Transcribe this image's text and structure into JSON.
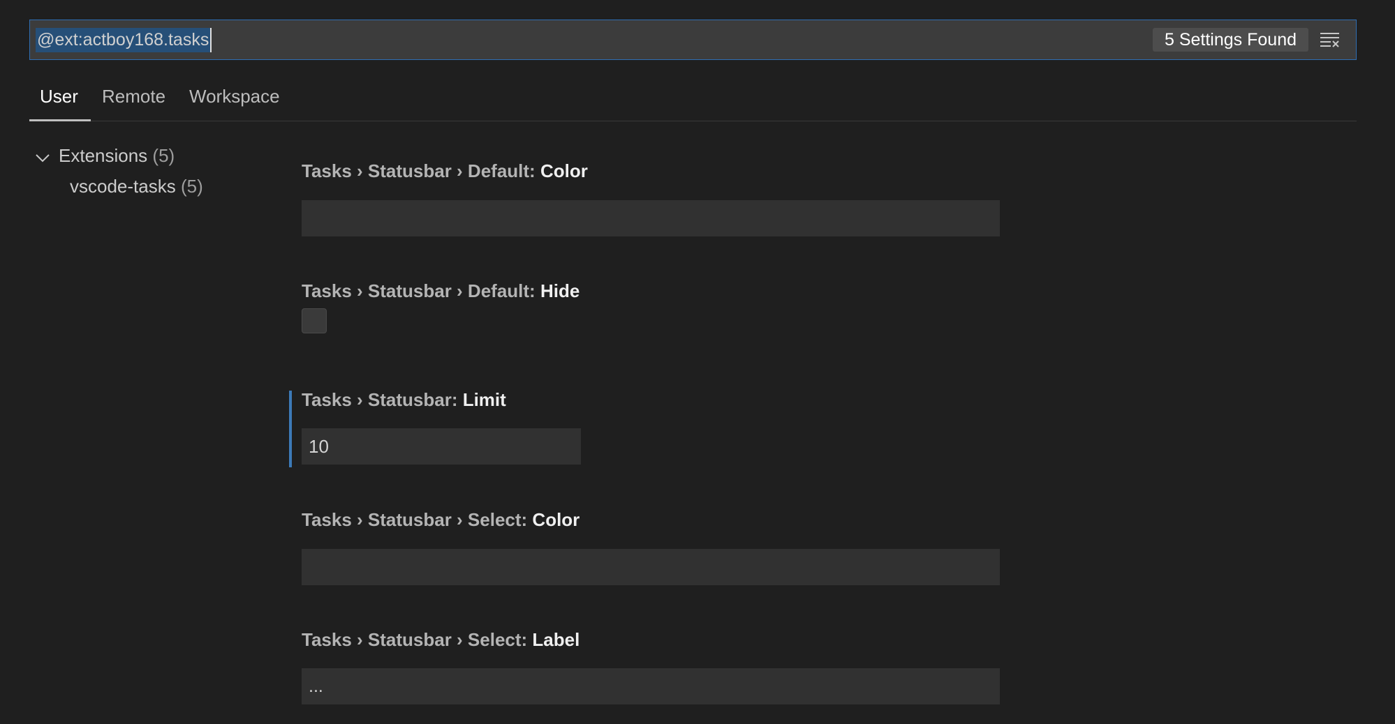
{
  "search": {
    "query": "@ext:actboy168.tasks",
    "results_count": "5 Settings Found",
    "clear_icon": "clear-filter-icon"
  },
  "tabs": [
    {
      "label": "User",
      "active": true
    },
    {
      "label": "Remote",
      "active": false
    },
    {
      "label": "Workspace",
      "active": false
    }
  ],
  "tree": {
    "group": {
      "label": "Extensions",
      "count": "(5)",
      "icon": "chevron-down-icon"
    },
    "item": {
      "label": "vscode-tasks",
      "count": "(5)"
    }
  },
  "settings": [
    {
      "prefix": "Tasks › Statusbar › Default: ",
      "key": "Color",
      "value": ""
    },
    {
      "prefix": "Tasks › Statusbar › Default: ",
      "key": "Hide",
      "checked": false
    },
    {
      "prefix": "Tasks › Statusbar: ",
      "key": "Limit",
      "value": "10"
    },
    {
      "prefix": "Tasks › Statusbar › Select: ",
      "key": "Color",
      "value": ""
    },
    {
      "prefix": "Tasks › Statusbar › Select: ",
      "key": "Label",
      "value": "..."
    }
  ],
  "colors": {
    "background": "#1f1f1f",
    "input_background": "#313131",
    "focus_border": "#2f6eb3",
    "selection": "#264f78",
    "modified_indicator": "#3c7ab8"
  }
}
